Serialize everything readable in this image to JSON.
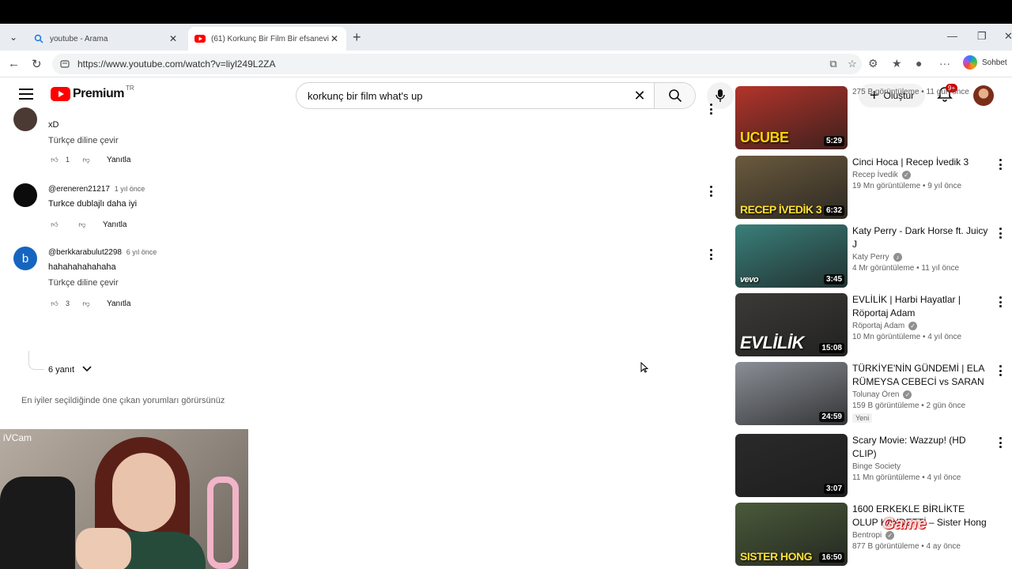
{
  "browser": {
    "tabs": [
      {
        "title": "youtube - Arama"
      },
      {
        "title": "(61) Korkunç Bir Film Bir efsanevi Vi"
      }
    ],
    "url": "https://www.youtube.com/watch?v=liyl249L2ZA",
    "copilot_label": "Sohbet"
  },
  "yt": {
    "logo_text": "Premium",
    "country": "TR",
    "search_query": "korkunç bir film what's up",
    "create_label": "Oluştur",
    "notifications": "9+"
  },
  "comments": [
    {
      "text": "xD",
      "translate": "Türkçe diline çevir",
      "likes": "1",
      "reply": "Yanıtla"
    },
    {
      "author": "@ereneren21217",
      "time": "1 yıl önce",
      "text": "Turkce dublajlı daha iyi",
      "reply": "Yanıtla"
    },
    {
      "author": "@berkkarabulut2298",
      "time": "6 yıl önce",
      "initial": "b",
      "text": "hahahahahahaha",
      "translate": "Türkçe diline çevir",
      "likes": "3",
      "reply": "Yanıtla"
    }
  ],
  "replies_toggle": "6 yanıt",
  "best_note": "En iyiler seçildiğinde öne çıkan yorumları görürsünüz",
  "webcam_label": "iVCam",
  "overlay_logo": "Game",
  "sidebar": [
    {
      "title": "",
      "channel": "",
      "stats": "275 B görüntüleme • 11 gün önce",
      "duration": "5:29",
      "thumb_text": "UCUBE",
      "thumb_color": "#b3342a"
    },
    {
      "title": "Cinci Hoca | Recep İvedik 3",
      "channel": "Recep İvedik",
      "stats": "19 Mn görüntüleme • 9 yıl önce",
      "duration": "6:32",
      "thumb_text": "RECEP İVEDİK 3",
      "thumb_color": "#6b5a3e"
    },
    {
      "title": "Katy Perry - Dark Horse ft. Juicy J",
      "channel": "Katy Perry",
      "stats": "4 Mr görüntüleme • 11 yıl önce",
      "duration": "3:45",
      "thumb_text": "vevo",
      "thumb_color": "#3a7f7a"
    },
    {
      "title": "EVLİLİK | Harbi Hayatlar | Röportaj Adam",
      "channel": "Röportaj Adam",
      "stats": "10 Mn görüntüleme • 4 yıl önce",
      "duration": "15:08",
      "thumb_text": "EVLİLİK",
      "thumb_color": "#3b3a38"
    },
    {
      "title": "TÜRKİYE'NİN GÜNDEMİ | ELA RÜMEYSA CEBECİ vs SARAN",
      "channel": "Tolunay Ören",
      "stats": "159 B görüntüleme • 2 gün önce",
      "badge": "Yeni",
      "duration": "24:59",
      "thumb_text": "",
      "thumb_color": "#8a8f96"
    },
    {
      "title": "Scary Movie: Wazzup! (HD CLIP)",
      "channel": "Binge Society",
      "stats": "11 Mn görüntüleme • 4 yıl önce",
      "duration": "3:07",
      "thumb_text": "",
      "thumb_color": "#2a2a2a"
    },
    {
      "title": "1600 ERKEKLE BİRLİKTE OLUP KAYDETTİ – Sister Hong",
      "channel": "Bentropi",
      "stats": "877 B görüntüleme • 4 ay önce",
      "duration": "16:50",
      "thumb_text": "SISTER HONG",
      "thumb_color": "#4a5a3a"
    }
  ]
}
